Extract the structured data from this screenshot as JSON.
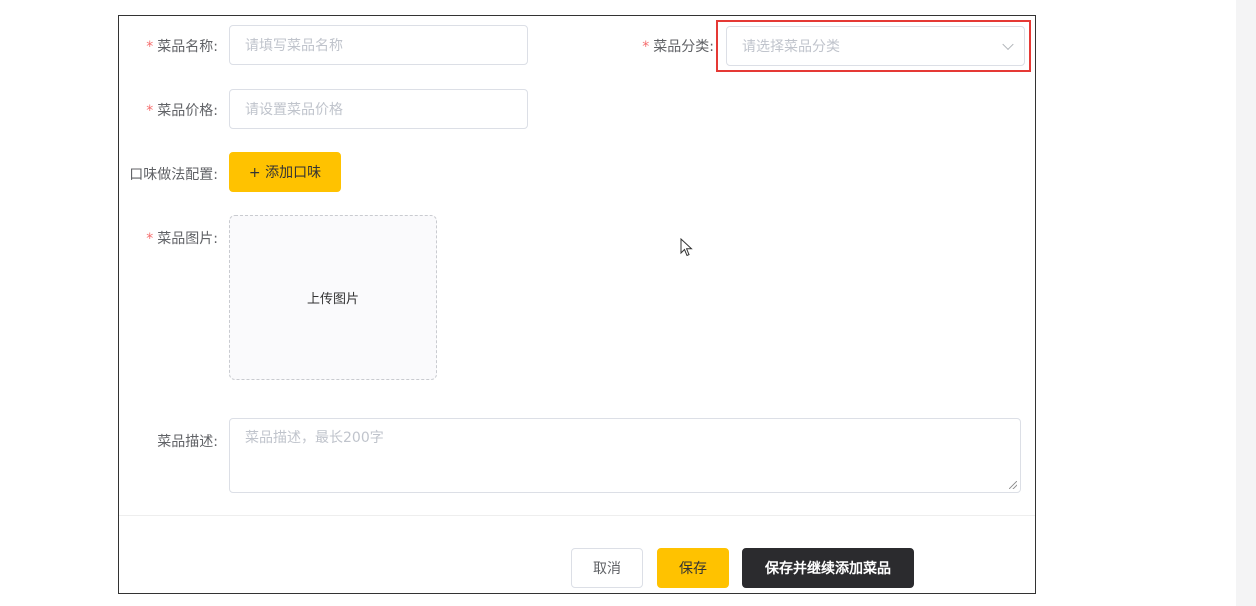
{
  "form": {
    "name": {
      "label": "菜品名称:",
      "placeholder": "请填写菜品名称"
    },
    "category": {
      "label": "菜品分类:",
      "placeholder": "请选择菜品分类"
    },
    "price": {
      "label": "菜品价格:",
      "placeholder": "请设置菜品价格"
    },
    "flavor": {
      "label": "口味做法配置:",
      "add_button": "+ 添加口味"
    },
    "image": {
      "label": "菜品图片:",
      "upload_text": "上传图片"
    },
    "description": {
      "label": "菜品描述:",
      "placeholder": "菜品描述，最长200字"
    },
    "required_mark": "*"
  },
  "actions": {
    "cancel": "取消",
    "save": "保存",
    "save_and_continue": "保存并继续添加菜品"
  },
  "colors": {
    "accent": "#ffc200",
    "dark_button": "#2b2b2e",
    "required": "#f56c6c",
    "highlight": "#e53935"
  },
  "icons": {
    "select_caret": "chevron-down-icon",
    "cursor": "mouse-pointer-icon"
  }
}
